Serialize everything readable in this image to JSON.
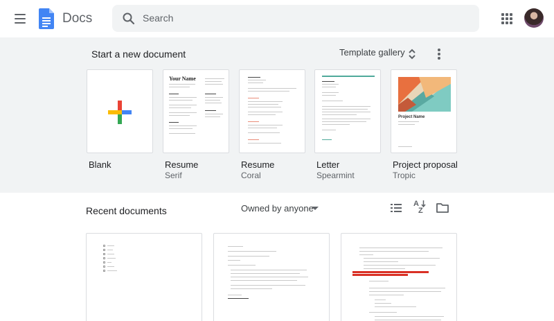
{
  "header": {
    "app_name": "Docs",
    "search_placeholder": "Search"
  },
  "templates": {
    "section_title": "Start a new document",
    "gallery_label": "Template gallery",
    "items": [
      {
        "name": "Blank",
        "sub": ""
      },
      {
        "name": "Resume",
        "sub": "Serif",
        "thumb_heading": "Your Name"
      },
      {
        "name": "Resume",
        "sub": "Coral"
      },
      {
        "name": "Letter",
        "sub": "Spearmint"
      },
      {
        "name": "Project proposal",
        "sub": "Tropic",
        "thumb_heading": "Project Name"
      }
    ]
  },
  "recent": {
    "title": "Recent documents",
    "owner_filter": "Owned by anyone"
  },
  "colors": {
    "header_bg": "#ffffff",
    "templates_bg": "#f1f3f4",
    "docs_blue": "#4285f4",
    "plus_red": "#ea4335",
    "plus_yellow": "#fbbc04",
    "plus_green": "#34a853",
    "plus_blue": "#4285f4"
  }
}
